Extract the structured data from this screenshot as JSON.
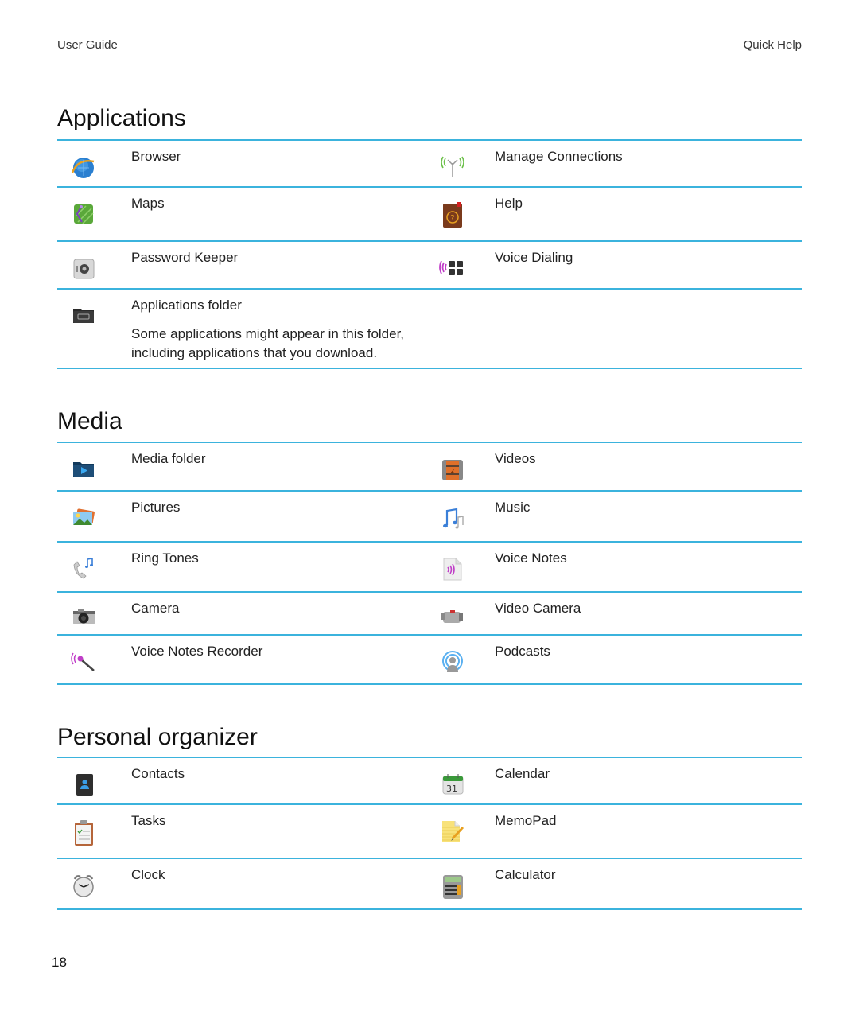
{
  "header": {
    "left": "User Guide",
    "right": "Quick Help"
  },
  "sections": [
    {
      "title": "Applications",
      "rows": [
        [
          {
            "label": "Browser",
            "icon": "globe-icon"
          },
          {
            "label": "Manage Connections",
            "icon": "antenna-icon"
          }
        ],
        [
          {
            "label": "Maps",
            "icon": "map-icon"
          },
          {
            "label": "Help",
            "icon": "help-book-icon"
          }
        ],
        [
          {
            "label": "Password Keeper",
            "icon": "safe-icon"
          },
          {
            "label": "Voice Dialing",
            "icon": "voice-keypad-icon"
          }
        ],
        [
          {
            "label": "Applications folder",
            "icon": "folder-icon",
            "description": "Some applications might appear in this folder, including applications that you download."
          },
          null
        ]
      ]
    },
    {
      "title": "Media",
      "rows": [
        [
          {
            "label": "Media folder",
            "icon": "media-folder-icon"
          },
          {
            "label": "Videos",
            "icon": "film-icon"
          }
        ],
        [
          {
            "label": "Pictures",
            "icon": "pictures-icon"
          },
          {
            "label": "Music",
            "icon": "music-notes-icon"
          }
        ],
        [
          {
            "label": "Ring Tones",
            "icon": "phone-note-icon"
          },
          {
            "label": "Voice Notes",
            "icon": "voice-note-file-icon"
          }
        ],
        [
          {
            "label": "Camera",
            "icon": "camera-icon"
          },
          {
            "label": "Video Camera",
            "icon": "camcorder-icon"
          }
        ],
        [
          {
            "label": "Voice Notes Recorder",
            "icon": "microphone-icon"
          },
          {
            "label": "Podcasts",
            "icon": "podcast-icon"
          }
        ]
      ]
    },
    {
      "title": "Personal organizer",
      "rows": [
        [
          {
            "label": "Contacts",
            "icon": "contacts-book-icon"
          },
          {
            "label": "Calendar",
            "icon": "calendar-icon",
            "day": "31"
          }
        ],
        [
          {
            "label": "Tasks",
            "icon": "clipboard-icon"
          },
          {
            "label": "MemoPad",
            "icon": "memo-pencil-icon"
          }
        ],
        [
          {
            "label": "Clock",
            "icon": "alarm-clock-icon"
          },
          {
            "label": "Calculator",
            "icon": "calculator-icon"
          }
        ]
      ]
    }
  ],
  "footer": {
    "page_number": "18"
  },
  "colors": {
    "divider": "#3bb3dd",
    "text": "#222222"
  }
}
